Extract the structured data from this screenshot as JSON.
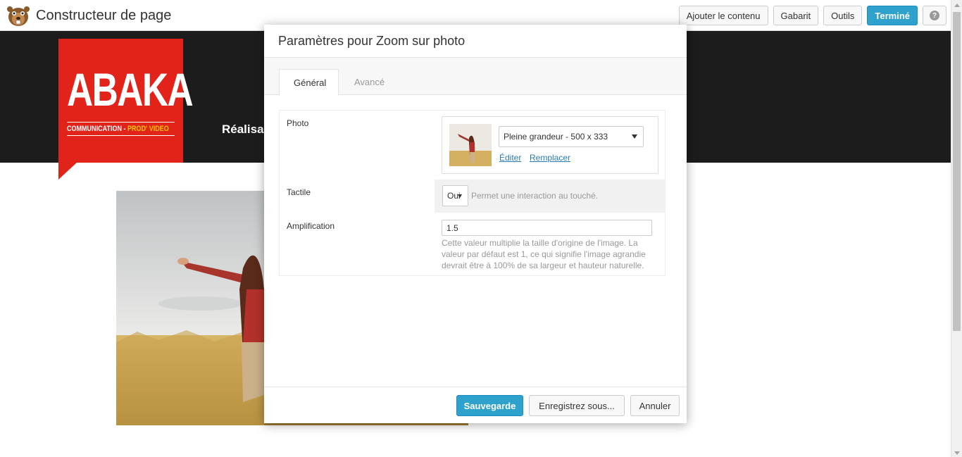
{
  "builder": {
    "title": "Constructeur de page",
    "logo_icon": "beaver-logo-icon",
    "buttons": {
      "add_content": "Ajouter le contenu",
      "template": "Gabarit",
      "tools": "Outils",
      "done": "Terminé",
      "help": "?"
    }
  },
  "site": {
    "brand_word": "ABAKA",
    "brand_sub_a": "COMMUNICATION - ",
    "brand_sub_b": "PROD' VIDEO",
    "nav_text": "Réalisa",
    "brand_color": "#e2231a"
  },
  "dialog": {
    "title": "Paramètres pour Zoom sur photo",
    "tabs": [
      "Général",
      "Avancé"
    ],
    "photo": {
      "label": "Photo",
      "size_select": "Pleine grandeur - 500 x 333",
      "edit_link": "Éditer",
      "replace_link": "Remplacer"
    },
    "tactile": {
      "label": "Tactile",
      "value": "Oui",
      "help": "Permet une interaction au touché."
    },
    "amplification": {
      "label": "Amplification",
      "value": "1.5",
      "help_lines": [
        "Cette valeur multiplie la taille d'origine de l'image. La",
        "valeur par défaut est 1, ce qui signifie l'image agrandie",
        "devrait être à 100% de sa largeur et hauteur naturelle."
      ]
    },
    "footer": {
      "save": "Sauvegarde",
      "save_as": "Enregistrez sous...",
      "cancel": "Annuler"
    }
  },
  "colors": {
    "primary": "#2ea2cc",
    "link": "#2a7cb0",
    "header_dark": "#1c1c1c"
  }
}
